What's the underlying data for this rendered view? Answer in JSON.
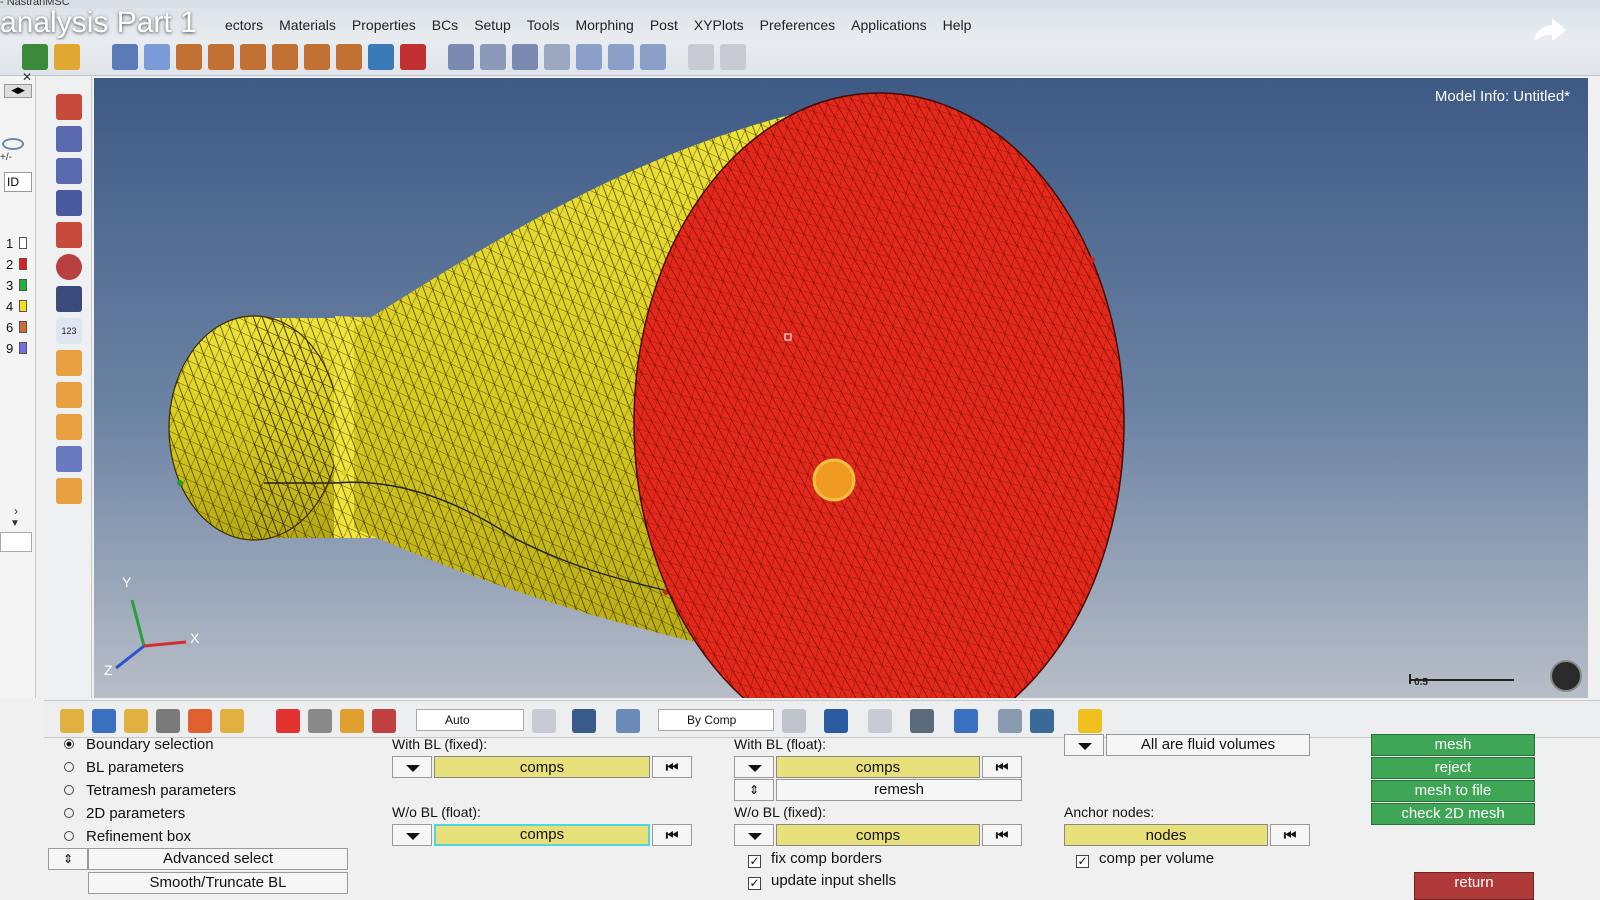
{
  "window": {
    "title_fragment": "- NastranMSC"
  },
  "video_overlay": {
    "title": "analysis Part 1"
  },
  "menu": [
    "ectors",
    "Materials",
    "Properties",
    "BCs",
    "Setup",
    "Tools",
    "Morphing",
    "Post",
    "XYPlots",
    "Preferences",
    "Applications",
    "Help"
  ],
  "left_strip": {
    "id_label": "ID",
    "plus_minus": "+/-",
    "legend": [
      {
        "id": "1",
        "color": "#ffffff"
      },
      {
        "id": "2",
        "color": "#e02020"
      },
      {
        "id": "3",
        "color": "#20b040"
      },
      {
        "id": "4",
        "color": "#f0e020"
      },
      {
        "id": "6",
        "color": "#d06a3a"
      },
      {
        "id": "9",
        "color": "#7070e0"
      }
    ]
  },
  "viewport": {
    "model_info": "Model Info: Untitled*",
    "scale_label": "0.5",
    "axes": {
      "x": "X",
      "y": "Y",
      "z": "Z"
    },
    "colors": {
      "cone": "#d8cd1e",
      "face": "#e5281c",
      "mesh_line": "#3a2a00"
    }
  },
  "bottom_toolbar": {
    "auto_combo": "Auto",
    "color_combo": "By Comp"
  },
  "panel": {
    "radios": [
      {
        "label": "Boundary selection",
        "selected": true
      },
      {
        "label": "BL parameters",
        "selected": false
      },
      {
        "label": "Tetramesh parameters",
        "selected": false
      },
      {
        "label": "2D parameters",
        "selected": false
      },
      {
        "label": "Refinement box",
        "selected": false
      }
    ],
    "advanced_select": "Advanced select",
    "smooth_truncate": "Smooth/Truncate BL",
    "with_bl_fixed": {
      "label": "With BL (fixed):",
      "value": "comps"
    },
    "wo_bl_float": {
      "label": "W/o BL (float):",
      "value": "comps"
    },
    "with_bl_float": {
      "label": "With BL (float):",
      "value": "comps"
    },
    "remesh": "remesh",
    "wo_bl_fixed": {
      "label": "W/o BL (fixed):",
      "value": "comps"
    },
    "fix_comp_borders": {
      "label": "fix comp borders",
      "checked": true
    },
    "update_input_shells": {
      "label": "update input shells",
      "checked": true
    },
    "fluid_volumes": "All are fluid volumes",
    "anchor_nodes": {
      "label": "Anchor nodes:",
      "value": "nodes"
    },
    "comp_per_volume": {
      "label": "comp per volume",
      "checked": true
    },
    "end_glyph": "⏮",
    "buttons": {
      "mesh": "mesh",
      "reject": "reject",
      "mesh_to_file": "mesh to file",
      "check_2d": "check 2D mesh",
      "return": "return"
    }
  }
}
